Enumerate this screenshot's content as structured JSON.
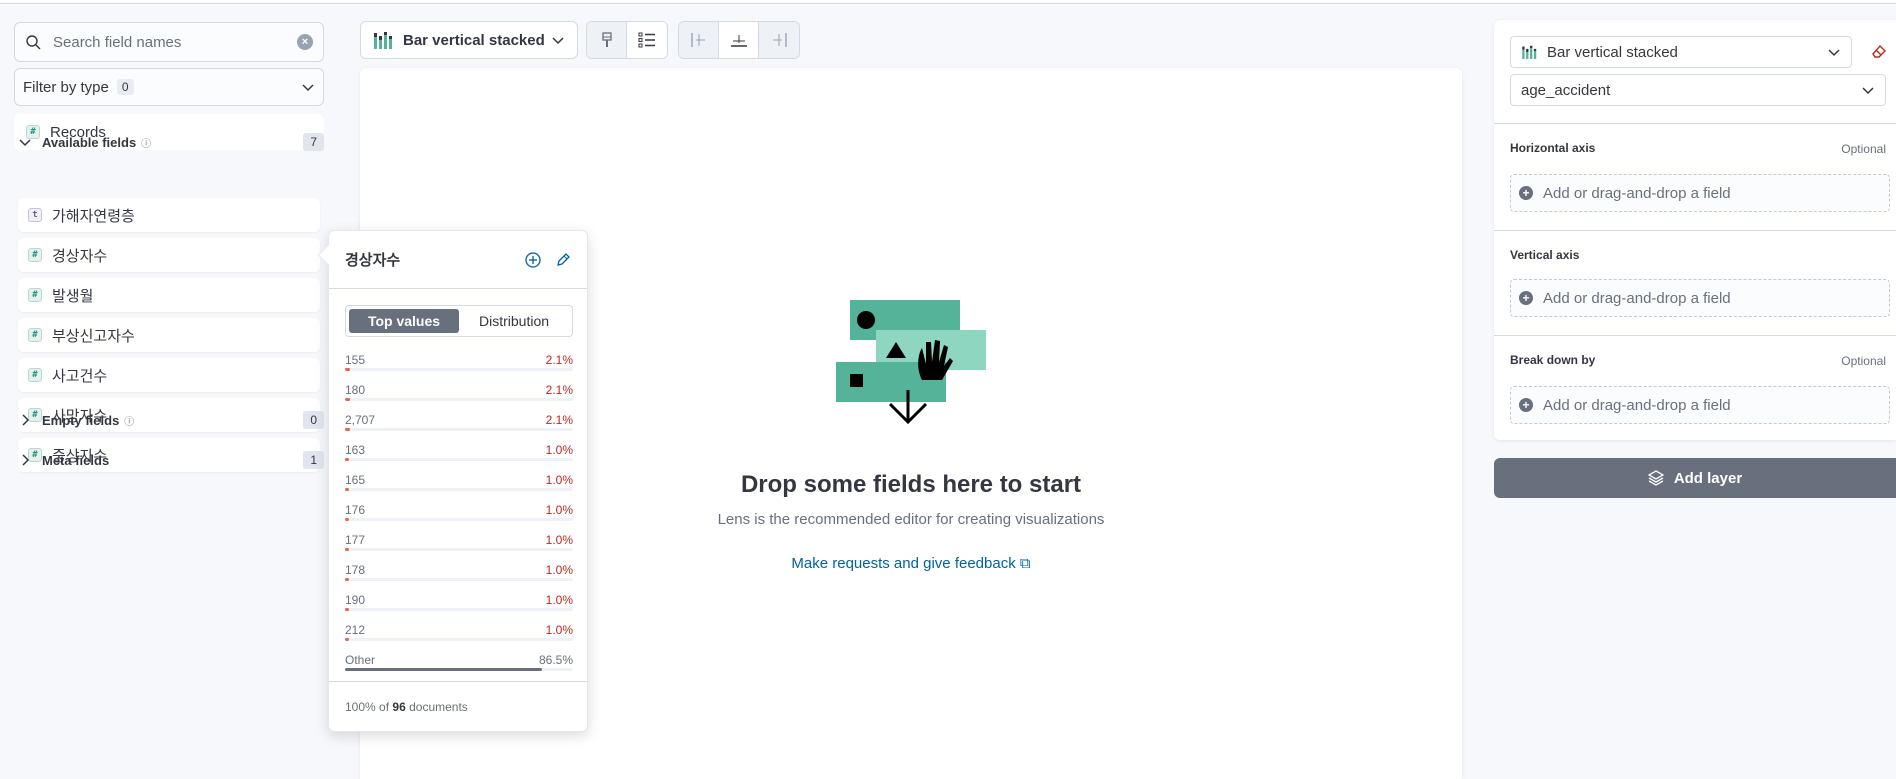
{
  "sidebar": {
    "search_placeholder": "Search field names",
    "filter_by_type": {
      "label": "Filter by type",
      "count": "0"
    },
    "records": "Records",
    "available": {
      "label": "Available fields",
      "count": "7"
    },
    "fields": [
      {
        "type": "t",
        "name": "가해자연령층"
      },
      {
        "type": "#",
        "name": "경상자수"
      },
      {
        "type": "#",
        "name": "발생월"
      },
      {
        "type": "#",
        "name": "부상신고자수"
      },
      {
        "type": "#",
        "name": "사고건수"
      },
      {
        "type": "#",
        "name": "사망자수"
      },
      {
        "type": "#",
        "name": "중상자수"
      }
    ],
    "empty": {
      "label": "Empty fields",
      "count": "0"
    },
    "meta": {
      "label": "Meta fields",
      "count": "1"
    }
  },
  "toolbar": {
    "chart_type": "Bar vertical stacked"
  },
  "workspace": {
    "title": "Drop some fields here to start",
    "subtitle": "Lens is the recommended editor for creating visualizations",
    "link": "Make requests and give feedback"
  },
  "popover": {
    "title": "경상자수",
    "tabs": [
      "Top values",
      "Distribution"
    ],
    "rows": [
      {
        "key": "155",
        "pct": "2.1%",
        "frac": 0.021
      },
      {
        "key": "180",
        "pct": "2.1%",
        "frac": 0.021
      },
      {
        "key": "2,707",
        "pct": "2.1%",
        "frac": 0.021
      },
      {
        "key": "163",
        "pct": "1.0%",
        "frac": 0.01
      },
      {
        "key": "165",
        "pct": "1.0%",
        "frac": 0.01
      },
      {
        "key": "176",
        "pct": "1.0%",
        "frac": 0.01
      },
      {
        "key": "177",
        "pct": "1.0%",
        "frac": 0.01
      },
      {
        "key": "178",
        "pct": "1.0%",
        "frac": 0.01
      },
      {
        "key": "190",
        "pct": "1.0%",
        "frac": 0.01
      },
      {
        "key": "212",
        "pct": "1.0%",
        "frac": 0.01
      }
    ],
    "other": {
      "key": "Other",
      "pct": "86.5%",
      "frac": 0.865
    },
    "footer": {
      "prefix": "100% of ",
      "count": "96",
      "suffix": " documents"
    }
  },
  "config": {
    "chart_type": "Bar vertical stacked",
    "index": "age_accident",
    "horizontal": {
      "label": "Horizontal axis",
      "optional": "Optional",
      "placeholder": "Add or drag-and-drop a field"
    },
    "vertical": {
      "label": "Vertical axis",
      "placeholder": "Add or drag-and-drop a field"
    },
    "breakdown": {
      "label": "Break down by",
      "optional": "Optional",
      "placeholder": "Add or drag-and-drop a field"
    },
    "add_layer": "Add layer"
  },
  "colors": {
    "accent": "#0061a6",
    "danger": "#bd271e",
    "illustration": "#54b399"
  }
}
